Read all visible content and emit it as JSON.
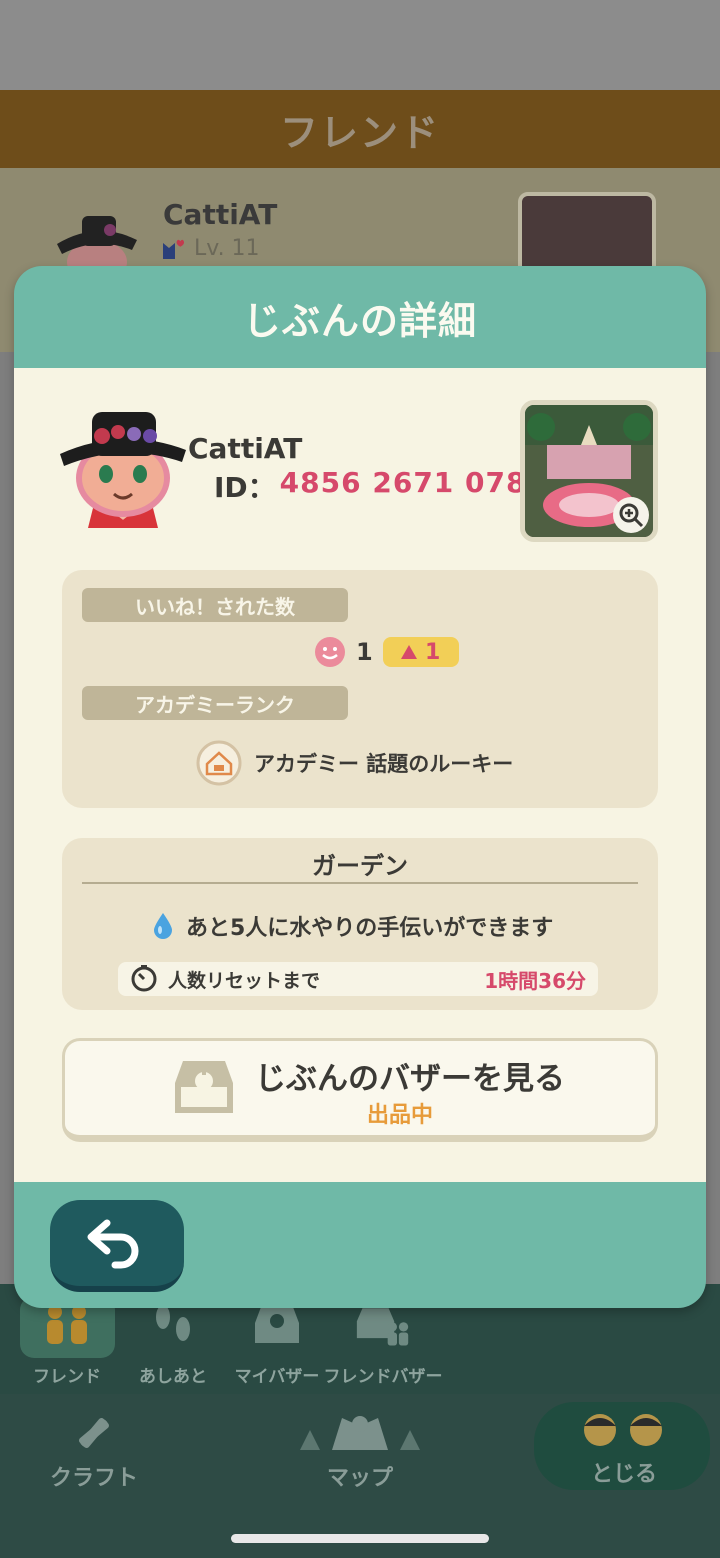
{
  "background": {
    "header_title": "フレンド",
    "friend": {
      "name": "CattiAT",
      "level": "Lv. 11"
    },
    "tabs": [
      {
        "label": "フレンド",
        "icon": "friends-icon"
      },
      {
        "label": "あしあと",
        "icon": "footprints-icon"
      },
      {
        "label": "マイバザー",
        "icon": "my-bazaar-icon"
      },
      {
        "label": "フレンドバザー",
        "icon": "friend-bazaar-icon"
      }
    ],
    "nav": {
      "craft": "クラフト",
      "map": "マップ",
      "close": "とじる"
    }
  },
  "modal": {
    "title": "じぶんの詳細",
    "player": {
      "name": "CattiAT",
      "id_label": "ID：",
      "id_value": "4856 2671 078"
    },
    "likes": {
      "label": "いいね！された数",
      "count": "1",
      "increase": "1"
    },
    "academy": {
      "label": "アカデミーランク",
      "rank": "アカデミー 話題のルーキー"
    },
    "garden": {
      "title": "ガーデン",
      "message": "あと5人に水やりの手伝いができます",
      "reset_label": "人数リセットまで",
      "reset_time": "1時間36分"
    },
    "bazaar": {
      "title": "じぶんのバザーを見る",
      "status": "出品中"
    }
  },
  "colors": {
    "modal_teal": "#6fb9a7",
    "accent_pink": "#d6496b",
    "accent_orange": "#e79b3a",
    "badge_yellow": "#f2cf57",
    "cream": "#f7f4e3"
  }
}
